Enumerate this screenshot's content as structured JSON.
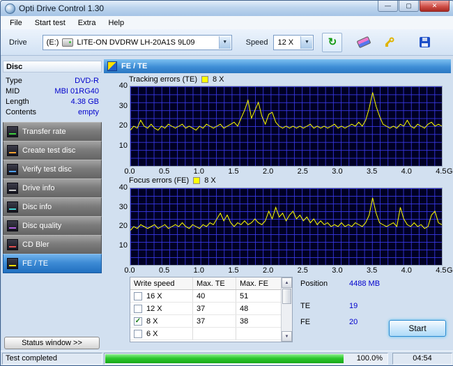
{
  "window": {
    "title": "Opti Drive Control 1.30"
  },
  "menu": {
    "items": [
      "File",
      "Start test",
      "Extra",
      "Help"
    ]
  },
  "toolbar": {
    "drive_label": "Drive",
    "drive_prefix": "(E:)",
    "drive_name": "LITE-ON DVDRW LH-20A1S 9L09",
    "speed_label": "Speed",
    "speed_value": "12 X"
  },
  "sidebar": {
    "group_header": "Disc",
    "info": [
      {
        "label": "Type",
        "value": "DVD-R"
      },
      {
        "label": "MID",
        "value": "MBI 01RG40"
      },
      {
        "label": "Length",
        "value": "4.38 GB"
      },
      {
        "label": "Contents",
        "value": "empty"
      }
    ],
    "buttons": [
      {
        "label": "Transfer rate"
      },
      {
        "label": "Create test disc"
      },
      {
        "label": "Verify test disc"
      },
      {
        "label": "Drive info"
      },
      {
        "label": "Disc info"
      },
      {
        "label": "Disc quality"
      },
      {
        "label": "CD Bler"
      },
      {
        "label": "FE / TE"
      }
    ],
    "status_button": "Status window >>"
  },
  "main": {
    "header": "FE / TE"
  },
  "table": {
    "headers": [
      "Write speed",
      "Max. TE",
      "Max. FE"
    ],
    "rows": [
      {
        "checked": false,
        "speed": "16 X",
        "max_te": "40",
        "max_fe": "51"
      },
      {
        "checked": false,
        "speed": "12 X",
        "max_te": "37",
        "max_fe": "48"
      },
      {
        "checked": true,
        "speed": "8 X",
        "max_te": "37",
        "max_fe": "38"
      },
      {
        "checked": false,
        "speed": "6 X",
        "max_te": "",
        "max_fe": ""
      }
    ]
  },
  "results": {
    "position_label": "Position",
    "position_value": "4488 MB",
    "te_label": "TE",
    "te_value": "19",
    "fe_label": "FE",
    "fe_value": "20",
    "start_label": "Start"
  },
  "statusbar": {
    "status": "Test completed",
    "progress_pct": "100.0%",
    "time": "04:54"
  },
  "chart_data": [
    {
      "id": "te",
      "type": "line",
      "title": "Tracking errors (TE)",
      "speed_label": "8 X",
      "color": "#ffff00",
      "ylim": [
        0,
        40
      ],
      "xlim": [
        0,
        4.5
      ],
      "xunit": "GB",
      "yticks": [
        40,
        30,
        20,
        10
      ],
      "xticks": [
        "0.0",
        "0.5",
        "1.0",
        "1.5",
        "2.0",
        "2.5",
        "3.0",
        "3.5",
        "4.0",
        "4.5"
      ],
      "x_step_gb": 0.05,
      "values": [
        18,
        20,
        19,
        23,
        20,
        19,
        21,
        19,
        18,
        20,
        19,
        21,
        20,
        19,
        20,
        21,
        19,
        20,
        19,
        18,
        20,
        19,
        21,
        20,
        19,
        20,
        21,
        19,
        20,
        21,
        22,
        20,
        24,
        28,
        33,
        24,
        28,
        32,
        25,
        21,
        26,
        27,
        22,
        20,
        19,
        20,
        19,
        20,
        19,
        20,
        19,
        20,
        21,
        19,
        20,
        19,
        20,
        19,
        20,
        21,
        19,
        20,
        19,
        20,
        21,
        20,
        22,
        20,
        23,
        29,
        37,
        30,
        25,
        21,
        20,
        19,
        20,
        19,
        21,
        20,
        23,
        20,
        19,
        21,
        20,
        19,
        21,
        22,
        20,
        21,
        20
      ]
    },
    {
      "id": "fe",
      "type": "line",
      "title": "Focus errors (FE)",
      "speed_label": "8 X",
      "color": "#ffff00",
      "ylim": [
        0,
        40
      ],
      "xlim": [
        0,
        4.5
      ],
      "xunit": "GB",
      "yticks": [
        40,
        30,
        20,
        10
      ],
      "xticks": [
        "0.0",
        "0.5",
        "1.0",
        "1.5",
        "2.0",
        "2.5",
        "3.0",
        "3.5",
        "4.0",
        "4.5"
      ],
      "x_step_gb": 0.05,
      "values": [
        18,
        20,
        19,
        21,
        20,
        19,
        20,
        21,
        19,
        20,
        21,
        19,
        20,
        21,
        20,
        22,
        20,
        19,
        21,
        20,
        19,
        21,
        20,
        22,
        21,
        24,
        27,
        23,
        26,
        22,
        20,
        22,
        21,
        23,
        21,
        22,
        24,
        22,
        21,
        23,
        28,
        24,
        30,
        25,
        27,
        23,
        26,
        28,
        24,
        26,
        23,
        25,
        22,
        24,
        21,
        23,
        21,
        22,
        20,
        21,
        20,
        22,
        20,
        21,
        20,
        22,
        21,
        20,
        22,
        26,
        35,
        27,
        22,
        21,
        20,
        21,
        22,
        20,
        30,
        24,
        21,
        20,
        22,
        20,
        21,
        19,
        20,
        26,
        28,
        22,
        21
      ]
    }
  ]
}
